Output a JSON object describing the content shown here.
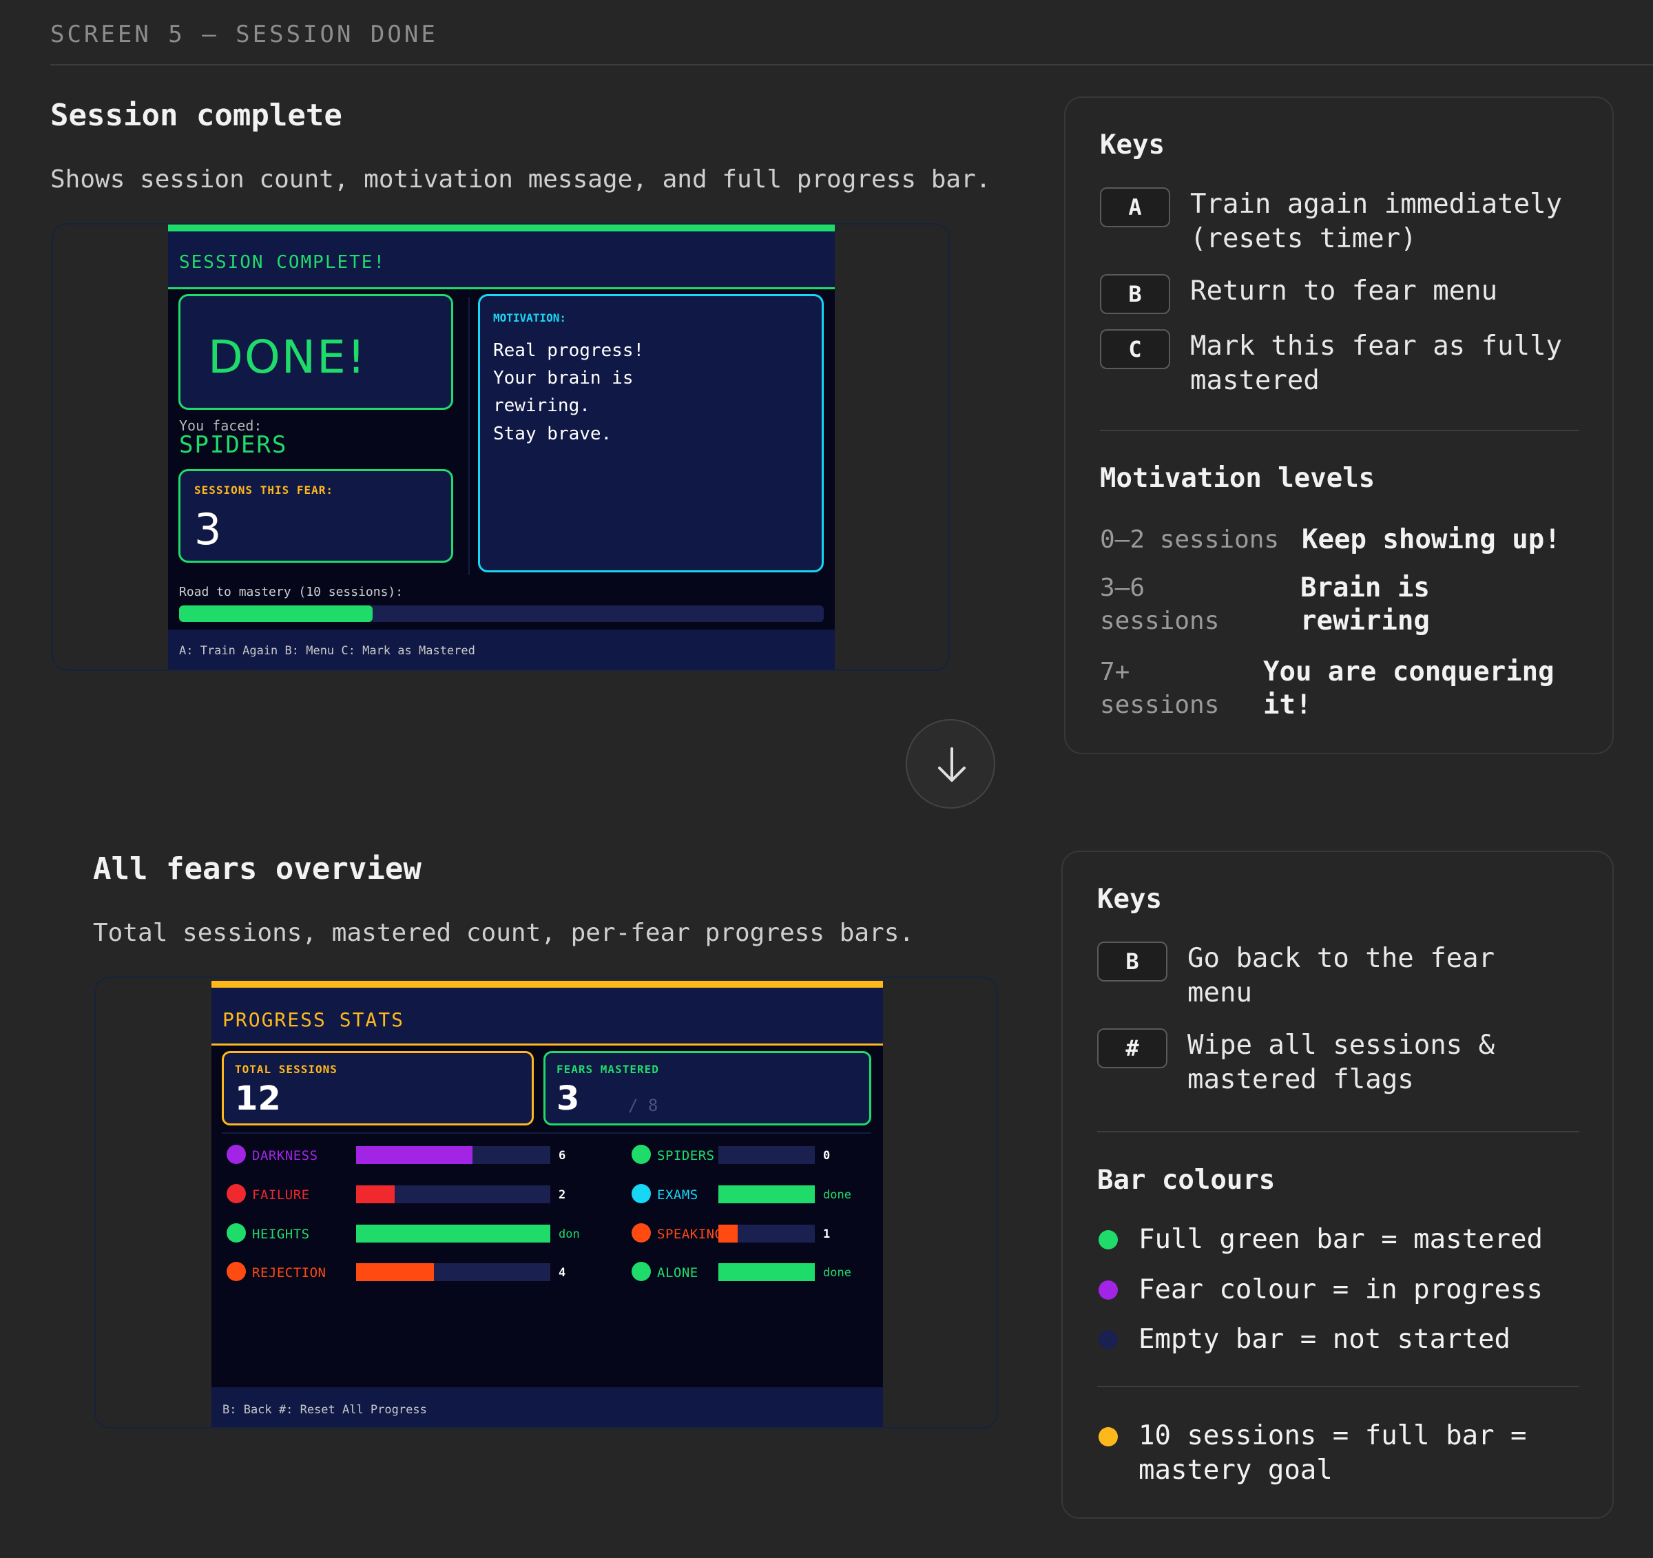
{
  "header": {
    "screen_label": "SCREEN 5 — SESSION DONE"
  },
  "session_section": {
    "title": "Session complete",
    "description": "Shows session count, motivation message, and full progress bar.",
    "screen": {
      "title": "SESSION COMPLETE!",
      "done_text": "DONE!",
      "faced_label": "You faced:",
      "faced_value": "SPIDERS",
      "sessions_label": "SESSIONS THIS FEAR:",
      "sessions_value": "3",
      "motivation_label": "MOTIVATION:",
      "motivation_lines": [
        "Real progress!",
        "Your brain is",
        "rewiring.",
        "Stay brave."
      ],
      "road_label": "Road to mastery (10 sessions):",
      "road_progress": 0.3,
      "footer": "A: Train Again B: Menu C: Mark as Mastered"
    },
    "panel": {
      "keys_title": "Keys",
      "keys": [
        {
          "key": "A",
          "lines": [
            "Train again immediately",
            "(resets timer)"
          ]
        },
        {
          "key": "B",
          "lines": [
            "Return to fear menu"
          ]
        },
        {
          "key": "C",
          "lines": [
            "Mark this fear as fully",
            "mastered"
          ]
        }
      ],
      "levels_title": "Motivation levels",
      "levels": [
        {
          "range": [
            "0–2 sessions"
          ],
          "message": [
            "Keep showing up!"
          ]
        },
        {
          "range": [
            "3–6",
            "sessions"
          ],
          "message": [
            "Brain is",
            "rewiring"
          ]
        },
        {
          "range": [
            "7+",
            "sessions"
          ],
          "message": [
            "You are conquering",
            "it!"
          ]
        }
      ]
    }
  },
  "overview_section": {
    "title": "All fears overview",
    "description": "Total sessions, mastered count, per-fear progress bars.",
    "screen": {
      "title": "PROGRESS STATS",
      "total_label": "TOTAL SESSIONS",
      "total_value": "12",
      "mastered_label": "FEARS MASTERED",
      "mastered_value": "3",
      "mastered_of": "/ 8",
      "fears_left": [
        {
          "name": "DARKNESS",
          "color": "#a225e6",
          "progress": 0.6,
          "count": "6"
        },
        {
          "name": "FAILURE",
          "color": "#f0292e",
          "progress": 0.2,
          "count": "2"
        },
        {
          "name": "HEIGHTS",
          "color": "#1fdc6a",
          "progress": 1.0,
          "count": "don"
        },
        {
          "name": "REJECTION",
          "color": "#ff4a12",
          "progress": 0.4,
          "count": "4"
        }
      ],
      "fears_right": [
        {
          "name": "SPIDERS",
          "color": "#1fdc6a",
          "progress": 0.0,
          "count": "0"
        },
        {
          "name": "EXAMS",
          "color": "#18d7f4",
          "progress": 1.0,
          "count": "done"
        },
        {
          "name": "SPEAKING",
          "color": "#ff4a12",
          "progress": 0.2,
          "count": "1"
        },
        {
          "name": "ALONE",
          "color": "#1fdc6a",
          "progress": 1.0,
          "count": "done"
        }
      ],
      "footer": "B: Back #: Reset All Progress"
    },
    "panel": {
      "keys_title": "Keys",
      "keys": [
        {
          "key": "B",
          "lines": [
            "Go back to the fear",
            "menu"
          ]
        },
        {
          "key": "#",
          "lines": [
            "Wipe all sessions &",
            "mastered flags"
          ]
        }
      ],
      "colours_title": "Bar colours",
      "colours": [
        {
          "color": "#1fdc6a",
          "text": [
            "Full green bar = mastered"
          ]
        },
        {
          "color": "#a225e6",
          "text": [
            "Fear colour = in progress"
          ]
        },
        {
          "color": "#1a2150",
          "text": [
            "Empty bar = not started"
          ]
        }
      ],
      "goal": {
        "color": "#ffb81c",
        "text": [
          "10 sessions = full bar =",
          "mastery goal"
        ]
      }
    }
  },
  "colors": {
    "green": "#1fdc6a",
    "cyan": "#18d7f4",
    "amber": "#ffb81c",
    "navy": "#101845",
    "track": "#1a2150"
  },
  "icons": {
    "scroll_arrow": "arrow-down-icon"
  }
}
